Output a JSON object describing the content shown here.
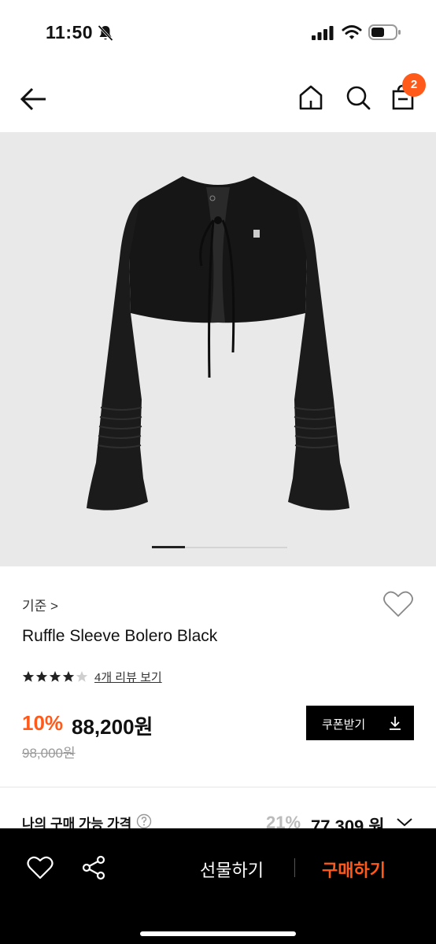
{
  "status": {
    "time": "11:50",
    "icons": [
      "bell-slash-icon",
      "signal-icon",
      "wifi-icon",
      "battery-icon"
    ]
  },
  "nav": {
    "icons": [
      "back-arrow-icon",
      "home-icon",
      "search-icon",
      "cart-icon"
    ],
    "cart_badge": "2"
  },
  "product": {
    "image_indicator": {
      "pages": 4,
      "active": 1
    },
    "brand": "기준 >",
    "name": "Ruffle Sleeve Bolero Black",
    "rating": 4,
    "rating_max": 5,
    "review_link": "4개 리뷰 보기",
    "discount_rate": "10%",
    "sale_price": "88,200원",
    "original_price": "98,000원",
    "coupon_button": "쿠폰받기"
  },
  "my_price": {
    "label": "나의 구매 가능 가격",
    "discount": "21%",
    "price": "77,309 원"
  },
  "bottom_bar": {
    "gift_label": "선물하기",
    "buy_label": "구매하기"
  },
  "colors": {
    "accent": "#ff5a1a",
    "bar_background": "#000000",
    "image_background": "#e9e9e9"
  }
}
